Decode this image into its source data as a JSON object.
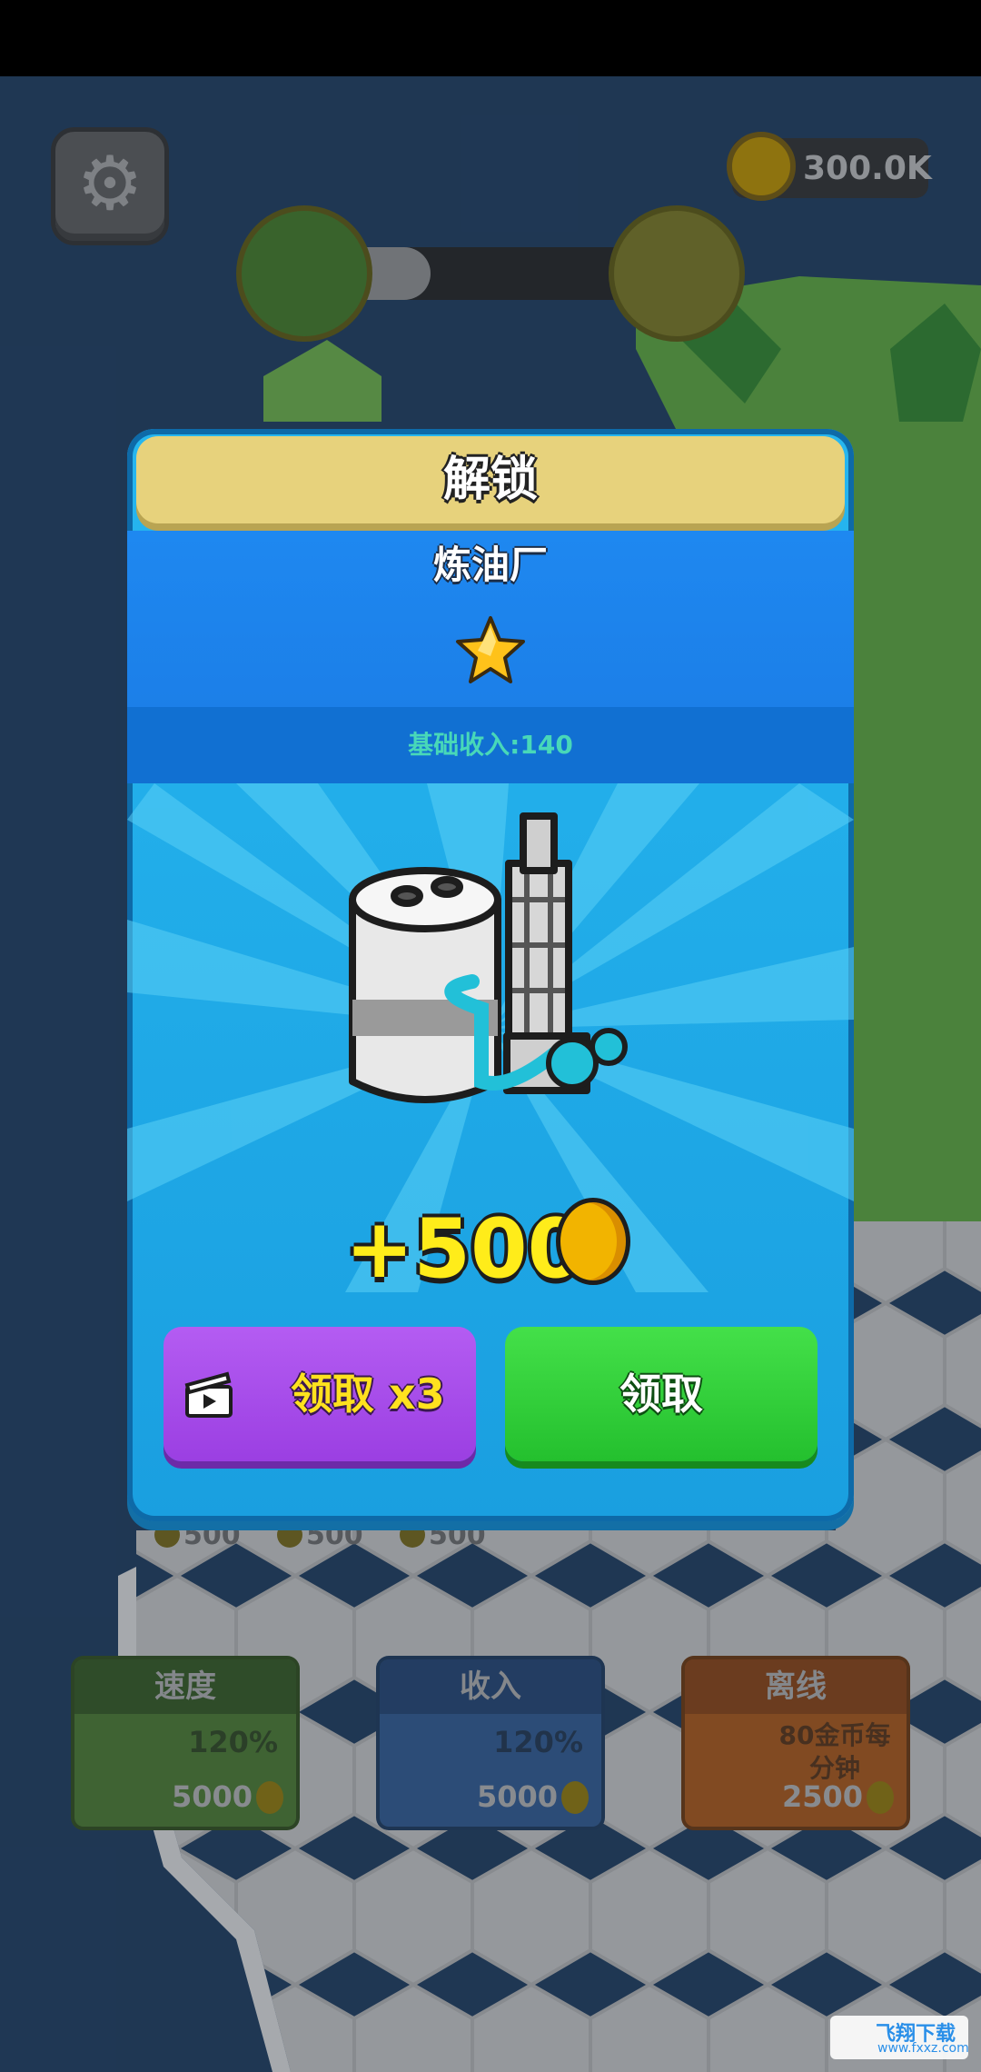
{
  "hud": {
    "coins": "300.0K"
  },
  "upgrades": [
    {
      "title": "速度",
      "value": "120%",
      "cost": "5000",
      "color": "#5a8f3a"
    },
    {
      "title": "收入",
      "value": "120%",
      "cost": "5000",
      "color": "#3a6aa8"
    },
    {
      "title": "离线",
      "value": "80金币每分钟",
      "cost": "2500",
      "color": "#c4671f"
    }
  ],
  "tile_prices": [
    "500",
    "500",
    "500"
  ],
  "popup": {
    "title": "解锁",
    "building_name": "炼油厂",
    "stars": 1,
    "income_label": "基础收入:140",
    "reward": "+500",
    "btn_x3": "领取 x3",
    "btn_claim": "领取"
  },
  "colors": {
    "popup_bg": "#1ea8ea",
    "header": "#e7d27c",
    "btn_x3": "#a94cea",
    "btn_claim": "#2ecc35"
  }
}
